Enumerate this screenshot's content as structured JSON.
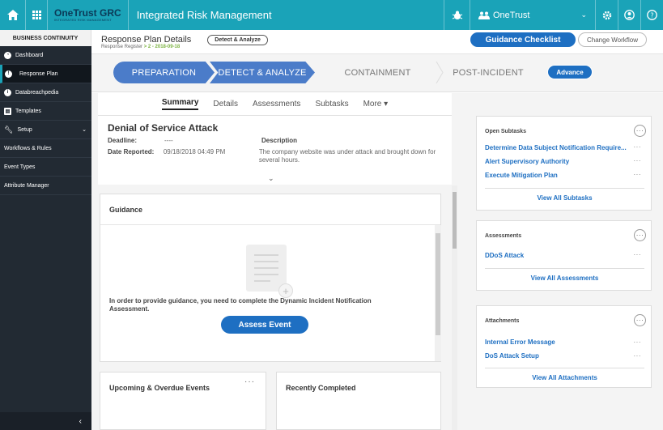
{
  "topbar": {
    "brand": "OneTrust GRC",
    "brand_sub": "INTEGRATED RISK MANAGEMENT",
    "app_title": "Integrated Risk Management",
    "org": "OneTrust"
  },
  "sidebar": {
    "header": "BUSINESS CONTINUITY",
    "items": [
      {
        "label": "Dashboard"
      },
      {
        "label": "Response Plan"
      },
      {
        "label": "Databreachpedia"
      },
      {
        "label": "Templates"
      },
      {
        "label": "Setup"
      },
      {
        "label": "Workflows & Rules"
      },
      {
        "label": "Event Types"
      },
      {
        "label": "Attribute Manager"
      }
    ],
    "collapse": "‹"
  },
  "header": {
    "title": "Response Plan Details",
    "crumb_prefix": "Response Register",
    "crumb_link": "> 2 - 2018-09-18",
    "stage_pill": "Detect & Analyze",
    "guidance_btn": "Guidance Checklist",
    "change_btn": "Change Workflow"
  },
  "stages": {
    "items": [
      "PREPARATION",
      "DETECT & ANALYZE",
      "CONTAINMENT",
      "POST-INCIDENT"
    ],
    "advance": "Advance"
  },
  "tabs": [
    "Summary",
    "Details",
    "Assessments",
    "Subtasks",
    "More ▾"
  ],
  "summary": {
    "title": "Denial of Service Attack",
    "deadline_label": "Deadline:",
    "deadline_value": "----",
    "reported_label": "Date Reported:",
    "reported_value": "09/18/2018 04:49 PM",
    "desc_label": "Description",
    "desc_value": "The company website was under attack and brought down for several hours."
  },
  "guidance": {
    "title": "Guidance",
    "text": "In order to provide guidance, you need to complete the Dynamic Incident Notification Assessment.",
    "button": "Assess Event"
  },
  "cards": {
    "upcoming": "Upcoming & Overdue Events",
    "completed": "Recently Completed"
  },
  "right": {
    "subtasks": {
      "title": "Open Subtasks",
      "items": [
        "Determine Data Subject Notification Require...",
        "Alert Supervisory Authority",
        "Execute Mitigation Plan"
      ],
      "link": "View All Subtasks"
    },
    "assessments": {
      "title": "Assessments",
      "items": [
        "DDoS Attack"
      ],
      "link": "View All Assessments"
    },
    "attachments": {
      "title": "Attachments",
      "items": [
        "Internal Error Message",
        "DoS Attack Setup"
      ],
      "link": "View All Attachments"
    }
  }
}
